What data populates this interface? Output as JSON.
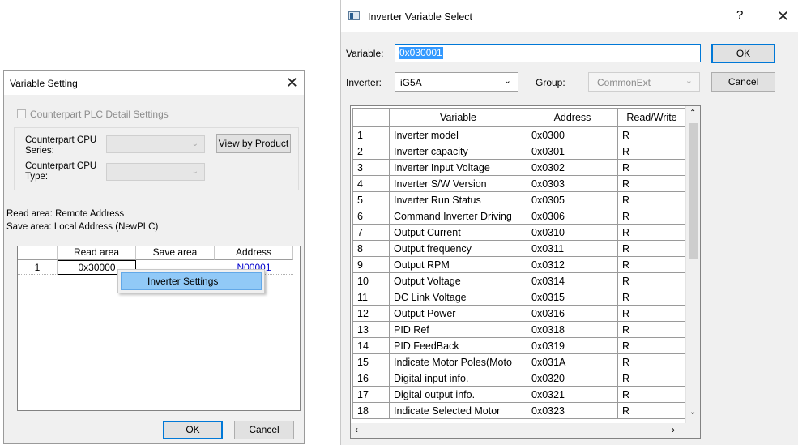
{
  "left_dialog": {
    "title": "Variable Setting",
    "close_glyph": "✕",
    "checkbox_label": "Counterpart PLC Detail Settings",
    "cpu_series_label": "Counterpart CPU Series:",
    "cpu_type_label": "Counterpart CPU Type:",
    "view_by_product": "View by Product",
    "read_area_text": "Read area: Remote Address",
    "save_area_text": "Save area: Local Address (NewPLC)",
    "grid": {
      "columns": [
        "",
        "Read area",
        "Save area",
        "Address"
      ],
      "rows": [
        {
          "num": "1",
          "read": "0x30000",
          "save": "",
          "address": "N00001"
        }
      ]
    },
    "context_menu": {
      "item": "Inverter Settings"
    },
    "ok": "OK",
    "cancel": "Cancel"
  },
  "right_dialog": {
    "title": "Inverter Variable Select",
    "help_glyph": "?",
    "close_glyph": "✕",
    "variable_label": "Variable:",
    "variable_value": "0x030001",
    "inverter_label": "Inverter:",
    "inverter_value": "iG5A",
    "group_label": "Group:",
    "group_value": "CommonExt",
    "ok": "OK",
    "cancel": "Cancel",
    "table": {
      "columns": [
        "",
        "Variable",
        "Address",
        "Read/Write"
      ],
      "rows": [
        [
          "1",
          "Inverter model",
          "0x0300",
          "R"
        ],
        [
          "2",
          "Inverter capacity",
          "0x0301",
          "R"
        ],
        [
          "3",
          "Inverter Input Voltage",
          "0x0302",
          "R"
        ],
        [
          "4",
          "Inverter S/W Version",
          "0x0303",
          "R"
        ],
        [
          "5",
          "Inverter Run Status",
          "0x0305",
          "R"
        ],
        [
          "6",
          "Command Inverter Driving",
          "0x0306",
          "R"
        ],
        [
          "7",
          "Output Current",
          "0x0310",
          "R"
        ],
        [
          "8",
          "Output frequency",
          "0x0311",
          "R"
        ],
        [
          "9",
          "Output RPM",
          "0x0312",
          "R"
        ],
        [
          "10",
          "Output Voltage",
          "0x0314",
          "R"
        ],
        [
          "11",
          "DC Link Voltage",
          "0x0315",
          "R"
        ],
        [
          "12",
          "Output Power",
          "0x0316",
          "R"
        ],
        [
          "13",
          "PID Ref",
          "0x0318",
          "R"
        ],
        [
          "14",
          "PID FeedBack",
          "0x0319",
          "R"
        ],
        [
          "15",
          "Indicate Motor Poles(Moto",
          "0x031A",
          "R"
        ],
        [
          "16",
          "Digital input info.",
          "0x0320",
          "R"
        ],
        [
          "17",
          "Digital output info.",
          "0x0321",
          "R"
        ],
        [
          "18",
          "Indicate Selected Motor",
          "0x0323",
          "R"
        ]
      ]
    }
  },
  "colors": {
    "accent": "#0078d7",
    "selection": "#3399ff",
    "context_highlight": "#91c9f7",
    "link_address": "#0000cc",
    "dialog_bg": "#f0f0f0"
  }
}
